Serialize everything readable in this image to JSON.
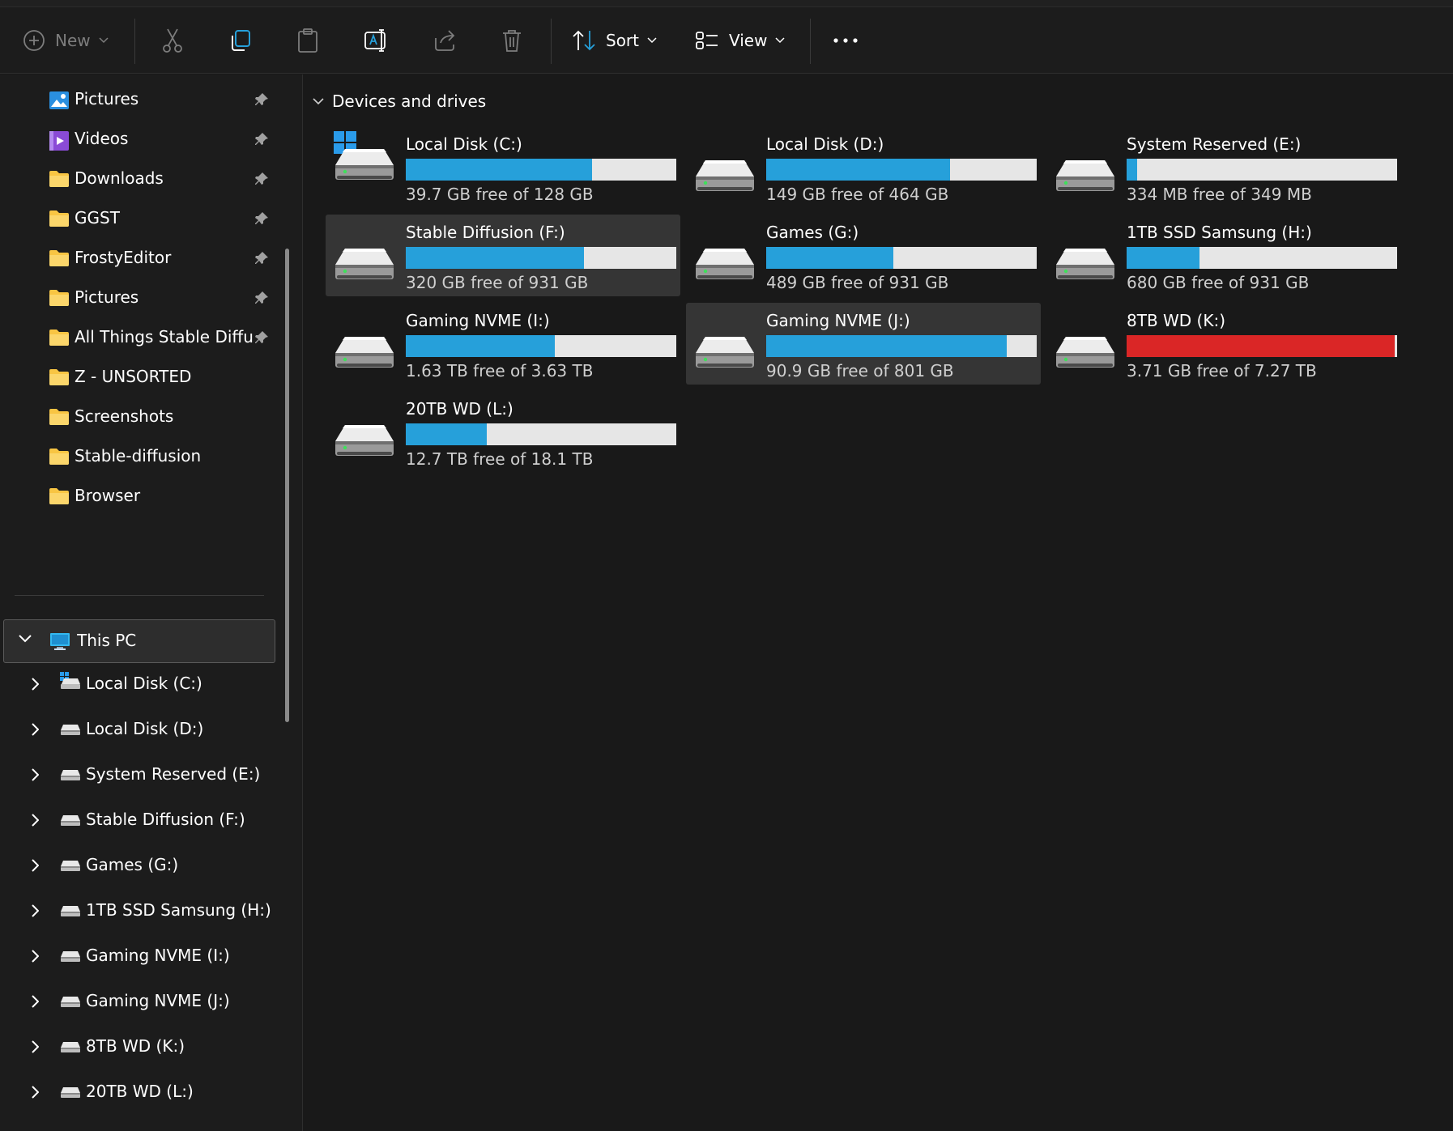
{
  "toolbar": {
    "new_label": "New",
    "sort_label": "Sort",
    "view_label": "View"
  },
  "colors": {
    "usage_bar": "#26a0da",
    "usage_bar_full": "#da2626",
    "usage_track": "#e6e6e6",
    "folder": "#f8c543"
  },
  "sidebar": {
    "quick_access": [
      {
        "label": "Pictures",
        "icon": "pictures-icon",
        "pinned": true
      },
      {
        "label": "Videos",
        "icon": "videos-icon",
        "pinned": true
      },
      {
        "label": "Downloads",
        "icon": "folder-icon",
        "pinned": true
      },
      {
        "label": "GGST",
        "icon": "folder-icon",
        "pinned": true
      },
      {
        "label": "FrostyEditor",
        "icon": "folder-icon",
        "pinned": true
      },
      {
        "label": "Pictures",
        "icon": "folder-icon",
        "pinned": true
      },
      {
        "label": "All Things Stable Diffusi",
        "icon": "folder-icon",
        "pinned": true
      },
      {
        "label": "Z - UNSORTED",
        "icon": "folder-icon",
        "pinned": false
      },
      {
        "label": "Screenshots",
        "icon": "folder-icon",
        "pinned": false
      },
      {
        "label": "Stable-diffusion",
        "icon": "folder-icon",
        "pinned": false
      },
      {
        "label": "Browser",
        "icon": "folder-icon",
        "pinned": false
      }
    ],
    "this_pc_label": "This PC",
    "drives": [
      {
        "label": "Local Disk (C:)",
        "icon": "windows-drive-icon"
      },
      {
        "label": "Local Disk (D:)",
        "icon": "drive-icon"
      },
      {
        "label": "System Reserved (E:)",
        "icon": "drive-icon"
      },
      {
        "label": "Stable Diffusion (F:)",
        "icon": "drive-icon"
      },
      {
        "label": "Games (G:)",
        "icon": "drive-icon"
      },
      {
        "label": "1TB SSD Samsung (H:)",
        "icon": "drive-icon"
      },
      {
        "label": "Gaming NVME (I:)",
        "icon": "drive-icon"
      },
      {
        "label": "Gaming NVME (J:)",
        "icon": "drive-icon"
      },
      {
        "label": "8TB WD (K:)",
        "icon": "drive-icon"
      },
      {
        "label": "20TB WD (L:)",
        "icon": "drive-icon"
      }
    ]
  },
  "main": {
    "section_title": "Devices and drives",
    "drives": [
      {
        "name": "Local Disk (C:)",
        "free_text": "39.7 GB free of 128 GB",
        "used_fraction": 0.69,
        "windows": true,
        "selected": false,
        "nearly_full": false
      },
      {
        "name": "Local Disk (D:)",
        "free_text": "149 GB free of 464 GB",
        "used_fraction": 0.68,
        "windows": false,
        "selected": false,
        "nearly_full": false
      },
      {
        "name": "System Reserved (E:)",
        "free_text": "334 MB free of 349 MB",
        "used_fraction": 0.04,
        "windows": false,
        "selected": false,
        "nearly_full": false
      },
      {
        "name": "Stable Diffusion (F:)",
        "free_text": "320 GB free of 931 GB",
        "used_fraction": 0.66,
        "windows": false,
        "selected": true,
        "nearly_full": false
      },
      {
        "name": "Games (G:)",
        "free_text": "489 GB free of 931 GB",
        "used_fraction": 0.47,
        "windows": false,
        "selected": false,
        "nearly_full": false
      },
      {
        "name": "1TB SSD Samsung (H:)",
        "free_text": "680 GB free of 931 GB",
        "used_fraction": 0.27,
        "windows": false,
        "selected": false,
        "nearly_full": false
      },
      {
        "name": "Gaming NVME (I:)",
        "free_text": "1.63 TB free of 3.63 TB",
        "used_fraction": 0.55,
        "windows": false,
        "selected": false,
        "nearly_full": false
      },
      {
        "name": "Gaming NVME (J:)",
        "free_text": "90.9 GB free of 801 GB",
        "used_fraction": 0.89,
        "windows": false,
        "selected": true,
        "nearly_full": false
      },
      {
        "name": "8TB WD (K:)",
        "free_text": "3.71 GB free of 7.27 TB",
        "used_fraction": 0.99,
        "windows": false,
        "selected": false,
        "nearly_full": true
      },
      {
        "name": "20TB WD (L:)",
        "free_text": "12.7 TB free of 18.1 TB",
        "used_fraction": 0.3,
        "windows": false,
        "selected": false,
        "nearly_full": false
      }
    ]
  }
}
